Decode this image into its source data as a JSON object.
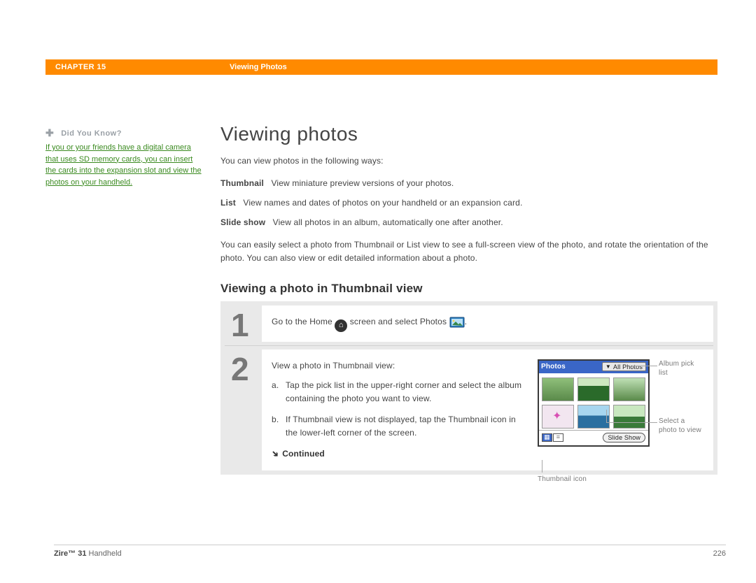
{
  "header": {
    "chapter": "CHAPTER 15",
    "section": "Viewing Photos"
  },
  "sidebar": {
    "dyk_title": "Did You Know?",
    "dyk_text": "If you or your friends have a digital camera that uses SD memory cards, you can insert the cards into the expansion slot and view the photos on your handheld."
  },
  "main": {
    "title": "Viewing photos",
    "intro": "You can view photos in the following ways:",
    "defs": {
      "thumb_k": "Thumbnail",
      "thumb_v": "View miniature preview versions of your photos.",
      "list_k": "List",
      "list_v": "View names and dates of photos on your handheld or an expansion card.",
      "slide_k": "Slide show",
      "slide_v": "View all photos in an album, automatically one after another."
    },
    "para2": "You can easily select a photo from Thumbnail or List view to see a full-screen view of the photo, and rotate the orientation of the photo. You can also view or edit detailed information about a photo.",
    "h2": "Viewing a photo in Thumbnail view",
    "steps": {
      "n1": "1",
      "n2": "2",
      "s1_a": "Go to the Home",
      "s1_b": "screen and select Photos",
      "s1_c": ".",
      "s2_lead": "View a photo in Thumbnail view:",
      "s2_a_mark": "a.",
      "s2_a": "Tap the pick list in the upper-right corner and select the album containing the photo you want to view.",
      "s2_b_mark": "b.",
      "s2_b": "If Thumbnail view is not displayed, tap the Thumbnail icon in the lower-left corner of the screen.",
      "continued": "Continued"
    },
    "shot": {
      "title": "Photos",
      "pick": "All Photos",
      "slideshow": "Slide Show",
      "c_pick": "Album pick list",
      "c_sel": "Select a photo to view",
      "c_thumb": "Thumbnail icon"
    }
  },
  "footer": {
    "prod_a": "Zire™ 31",
    "prod_b": "Handheld",
    "page": "226"
  }
}
